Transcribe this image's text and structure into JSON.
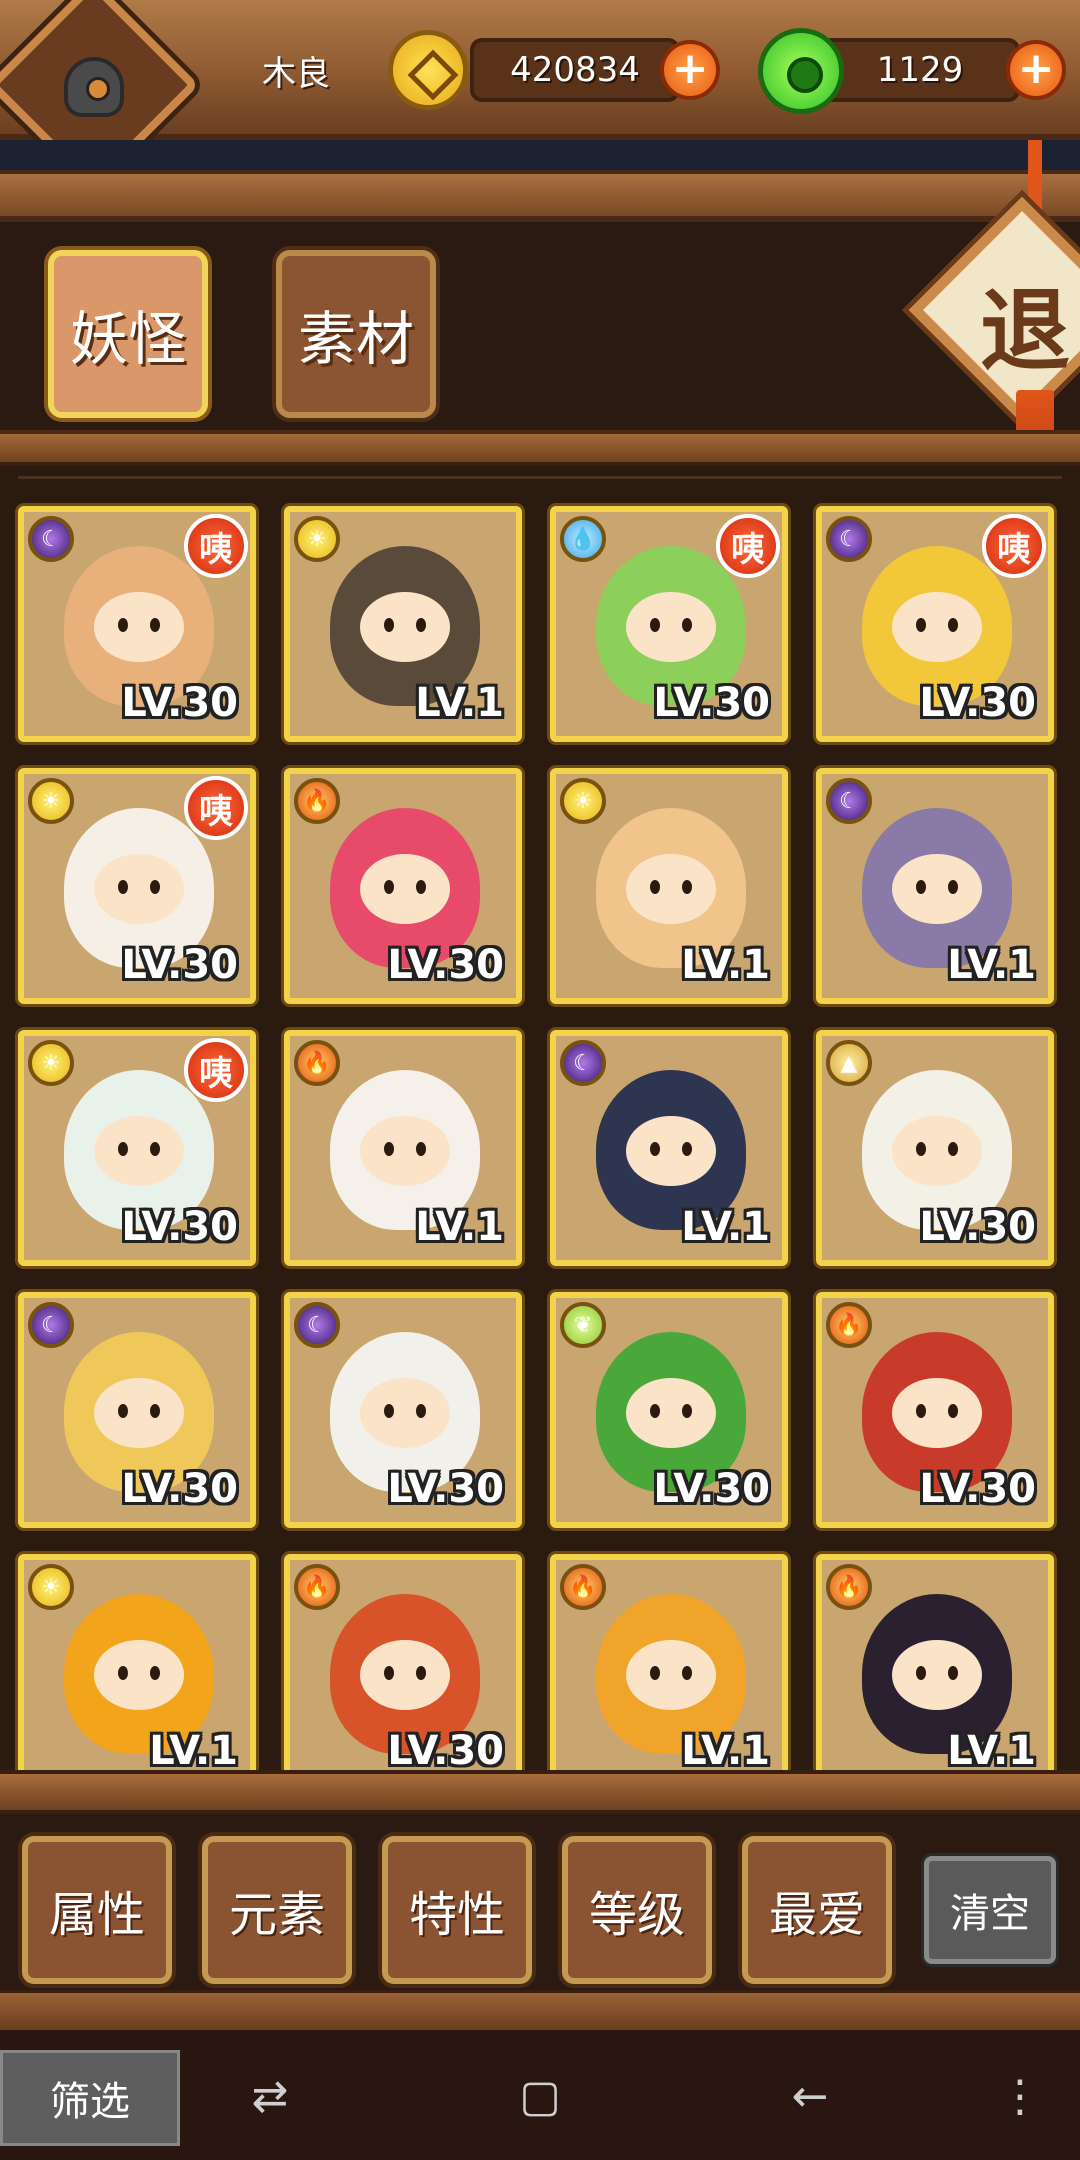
{
  "player": {
    "name": "木良"
  },
  "resources": {
    "coins": "420834",
    "gems": "1129"
  },
  "tabs": [
    {
      "label": "妖怪"
    },
    {
      "label": "素材"
    }
  ],
  "exit_label": "退",
  "badge_text": "咦",
  "monsters": [
    {
      "element": "dark",
      "level": "LV.30",
      "badge": true,
      "art_color": "#e8b07a"
    },
    {
      "element": "light",
      "level": "LV.1",
      "badge": false,
      "art_color": "#5a4a3a"
    },
    {
      "element": "water",
      "level": "LV.30",
      "badge": true,
      "art_color": "#8ccf5a"
    },
    {
      "element": "dark",
      "level": "LV.30",
      "badge": true,
      "art_color": "#f2c83a"
    },
    {
      "element": "light",
      "level": "LV.30",
      "badge": true,
      "art_color": "#f5efe6"
    },
    {
      "element": "fire",
      "level": "LV.30",
      "badge": false,
      "art_color": "#e84a6a"
    },
    {
      "element": "light",
      "level": "LV.1",
      "badge": false,
      "art_color": "#f0c48a"
    },
    {
      "element": "dark",
      "level": "LV.1",
      "badge": false,
      "art_color": "#8a7aa8"
    },
    {
      "element": "light",
      "level": "LV.30",
      "badge": true,
      "art_color": "#e8f2ea"
    },
    {
      "element": "fire",
      "level": "LV.1",
      "badge": false,
      "art_color": "#f5f0ea"
    },
    {
      "element": "dark",
      "level": "LV.1",
      "badge": false,
      "art_color": "#2e3550"
    },
    {
      "element": "earth",
      "level": "LV.30",
      "badge": false,
      "art_color": "#f3f0e6"
    },
    {
      "element": "dark",
      "level": "LV.30",
      "badge": false,
      "art_color": "#f0c85a"
    },
    {
      "element": "dark",
      "level": "LV.30",
      "badge": false,
      "art_color": "#f2f0ea"
    },
    {
      "element": "wind",
      "level": "LV.30",
      "badge": false,
      "art_color": "#4aa83a"
    },
    {
      "element": "fire",
      "level": "LV.30",
      "badge": false,
      "art_color": "#c83a2a"
    },
    {
      "element": "light",
      "level": "LV.1",
      "badge": false,
      "art_color": "#f2a41a"
    },
    {
      "element": "fire",
      "level": "LV.30",
      "badge": false,
      "art_color": "#d8532a"
    },
    {
      "element": "fire",
      "level": "LV.1",
      "badge": false,
      "art_color": "#f0a42a"
    },
    {
      "element": "fire",
      "level": "LV.1",
      "badge": false,
      "art_color": "#2a2030"
    }
  ],
  "filters": [
    {
      "label": "属性"
    },
    {
      "label": "元素"
    },
    {
      "label": "特性"
    },
    {
      "label": "等级"
    },
    {
      "label": "最爱"
    }
  ],
  "clear_label": "清空",
  "nav": {
    "filter_label": "筛选",
    "icons": [
      "swap-icon",
      "square-icon",
      "back-arrow-icon",
      "menu-icon"
    ]
  }
}
